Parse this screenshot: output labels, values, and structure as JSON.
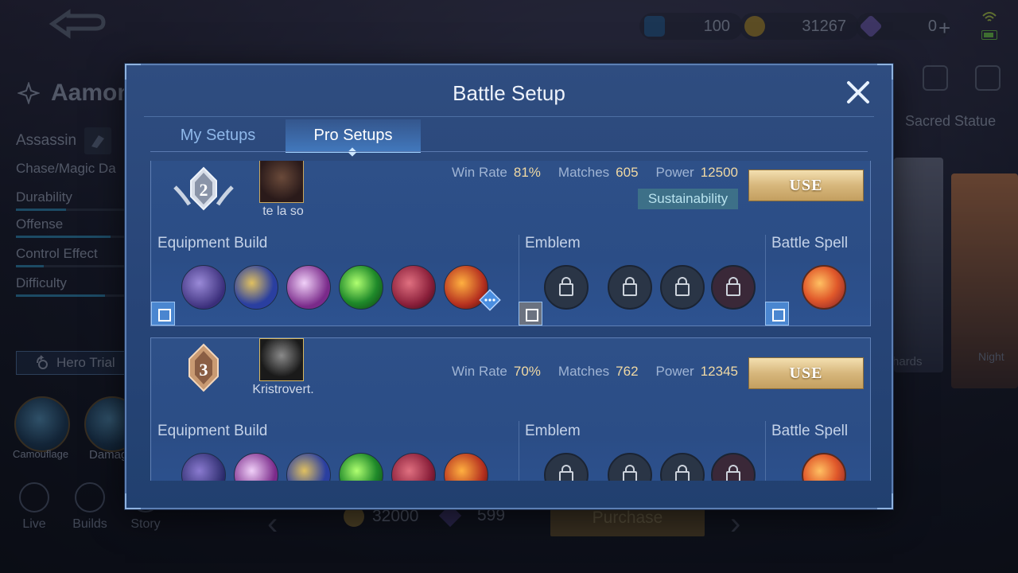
{
  "top_bar": {
    "currencies": [
      {
        "name": "tickets",
        "value": "100",
        "icon": "m-ticket-icon"
      },
      {
        "name": "battle-points",
        "value": "31267",
        "icon": "coin-icon"
      },
      {
        "name": "diamonds",
        "value": "0",
        "icon": "diamond-icon"
      }
    ],
    "plus_label": "+"
  },
  "hero": {
    "name": "Aamon",
    "role": "Assassin",
    "subrole": "Chase/Magic Da",
    "stats": [
      {
        "label": "Durability",
        "fill": 0.45
      },
      {
        "label": "Offense",
        "fill": 0.85
      },
      {
        "label": "Control Effect",
        "fill": 0.25
      },
      {
        "label": "Difficulty",
        "fill": 0.8
      }
    ],
    "trial_label": "Hero Trial",
    "skills": [
      "Camouflage",
      "Damag"
    ]
  },
  "bottom_nav": [
    "Live",
    "Builds",
    "Story"
  ],
  "right_panel": {
    "sacred_statue": "Sacred Statue",
    "shards": "Shards",
    "night": "Night"
  },
  "purchase_bar": {
    "coins": "32000",
    "diamonds": "599",
    "purchase_label": "Purchase"
  },
  "dialog": {
    "title": "Battle Setup",
    "tabs": [
      {
        "label": "My Setups",
        "active": false
      },
      {
        "label": "Pro Setups",
        "active": true
      }
    ],
    "section_labels": {
      "equipment": "Equipment Build",
      "emblem": "Emblem",
      "spell": "Battle Spell"
    },
    "stat_labels": {
      "win_rate": "Win Rate",
      "matches": "Matches",
      "power": "Power"
    },
    "use_label": "USE",
    "setups": [
      {
        "rank": "2",
        "player": "te la so",
        "win_rate": "81%",
        "matches": "605",
        "power": "12500",
        "tag": "Sustainability",
        "items": [
          "#3a2e7a",
          "#2a3fa0",
          "#7a2a8a",
          "#1f8a2a",
          "#8a1f3a",
          "#b5301f"
        ]
      },
      {
        "rank": "3",
        "player": "Kristrovert.",
        "win_rate": "70%",
        "matches": "762",
        "power": "12345",
        "tag": "",
        "items": [
          "#2a2a6a",
          "#7a2a8a",
          "#2a3fa0",
          "#1f8a2a",
          "#8a1f3a",
          "#b5301f"
        ]
      }
    ]
  },
  "colors": {
    "accent_gold": "#f0d9a4",
    "dialog_bg": "#284578",
    "tab_active": "#9fd0ff"
  }
}
